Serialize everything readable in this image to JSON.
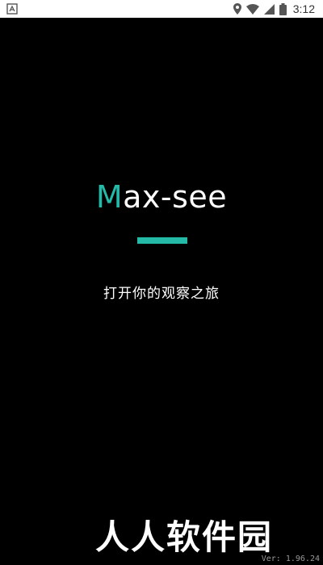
{
  "status_bar": {
    "time": "3:12",
    "icons": [
      "notification-icon",
      "location-icon",
      "wifi-icon",
      "signal-icon",
      "battery-icon"
    ]
  },
  "splash": {
    "logo_first_letter": "M",
    "logo_rest": "ax-see",
    "tagline": "打开你的观察之旅",
    "watermark": "人人软件园",
    "version": "Ver: 1.96.24"
  },
  "colors": {
    "accent": "#25b9a8",
    "background": "#000000",
    "status_bar": "#ffffff"
  }
}
